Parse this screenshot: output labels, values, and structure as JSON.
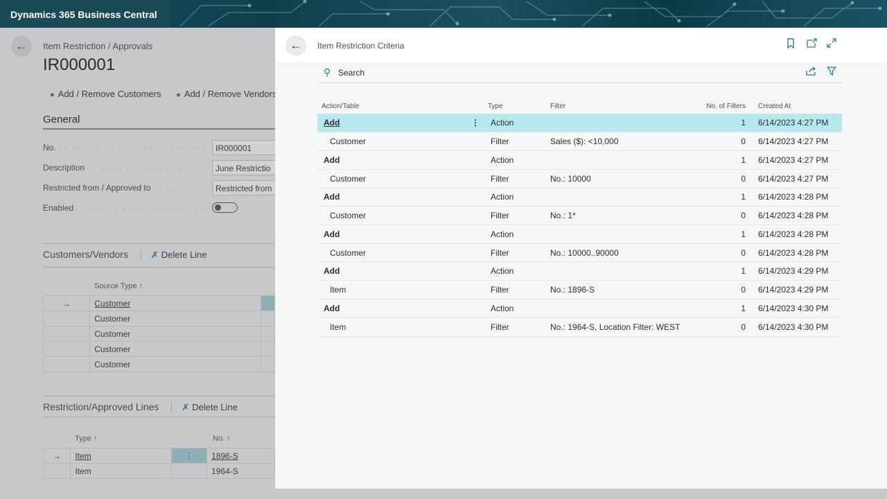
{
  "app": {
    "title": "Dynamics 365 Business Central"
  },
  "background_page": {
    "breadcrumb": "Item Restriction / Approvals",
    "title": "IR000001",
    "actions": [
      "Add / Remove Customers",
      "Add / Remove Vendors"
    ],
    "general_heading": "General",
    "fields": [
      {
        "label": "No.",
        "value": "IR000001"
      },
      {
        "label": "Description",
        "value": "June Restrictio"
      },
      {
        "label": "Restricted from / Approved to",
        "value": "Restricted from"
      },
      {
        "label": "Enabled",
        "value": ""
      }
    ],
    "customers_vendors": {
      "heading": "Customers/Vendors",
      "delete_label": "Delete Line",
      "column": "Source Type ↑",
      "rows": [
        "Customer",
        "Customer",
        "Customer",
        "Customer",
        "Customer"
      ]
    },
    "restriction_lines": {
      "heading": "Restriction/Approved Lines",
      "delete_label": "Delete Line",
      "col_type": "Type ↑",
      "col_no": "No. ↑",
      "rows": [
        {
          "type": "Item",
          "no": "1896-S"
        },
        {
          "type": "Item",
          "no": "1964-S"
        }
      ]
    }
  },
  "panel": {
    "title": "Item Restriction Criteria",
    "search_label": "Search",
    "columns": {
      "action_table": "Action/Table",
      "type": "Type",
      "filter": "Filter",
      "no_of_filters": "No. of Filters",
      "created_at": "Created At"
    },
    "rows": [
      {
        "action_table": "Add",
        "type": "Action",
        "filter": "",
        "no_of_filters": "1",
        "created_at": "6/14/2023 4:27 PM"
      },
      {
        "action_table": "Customer",
        "type": "Filter",
        "filter": "Sales ($): <10,000",
        "no_of_filters": "0",
        "created_at": "6/14/2023 4:27 PM"
      },
      {
        "action_table": "Add",
        "type": "Action",
        "filter": "",
        "no_of_filters": "1",
        "created_at": "6/14/2023 4:27 PM"
      },
      {
        "action_table": "Customer",
        "type": "Filter",
        "filter": "No.: 10000",
        "no_of_filters": "0",
        "created_at": "6/14/2023 4:27 PM"
      },
      {
        "action_table": "Add",
        "type": "Action",
        "filter": "",
        "no_of_filters": "1",
        "created_at": "6/14/2023 4:28 PM"
      },
      {
        "action_table": "Customer",
        "type": "Filter",
        "filter": "No.: 1*",
        "no_of_filters": "0",
        "created_at": "6/14/2023 4:28 PM"
      },
      {
        "action_table": "Add",
        "type": "Action",
        "filter": "",
        "no_of_filters": "1",
        "created_at": "6/14/2023 4:28 PM"
      },
      {
        "action_table": "Customer",
        "type": "Filter",
        "filter": "No.: 10000..90000",
        "no_of_filters": "0",
        "created_at": "6/14/2023 4:28 PM"
      },
      {
        "action_table": "Add",
        "type": "Action",
        "filter": "",
        "no_of_filters": "1",
        "created_at": "6/14/2023 4:29 PM"
      },
      {
        "action_table": "Item",
        "type": "Filter",
        "filter": "No.: 1896-S",
        "no_of_filters": "0",
        "created_at": "6/14/2023 4:29 PM"
      },
      {
        "action_table": "Add",
        "type": "Action",
        "filter": "",
        "no_of_filters": "1",
        "created_at": "6/14/2023 4:30 PM"
      },
      {
        "action_table": "Item",
        "type": "Filter",
        "filter": "No.: 1964-S, Location Filter: WEST",
        "no_of_filters": "0",
        "created_at": "6/14/2023 4:30 PM"
      }
    ],
    "selected_row": 0
  },
  "colors": {
    "accent": "#2d7c8c",
    "selected_row": "#b8e8ee",
    "topbar": "#123e4b"
  },
  "icons": {
    "back": "back-arrow-icon",
    "bookmark": "bookmark-icon",
    "open_new": "open-in-new-window-icon",
    "expand": "expand-icon",
    "search": "search-icon",
    "share": "share-icon",
    "filter": "filter-icon"
  }
}
